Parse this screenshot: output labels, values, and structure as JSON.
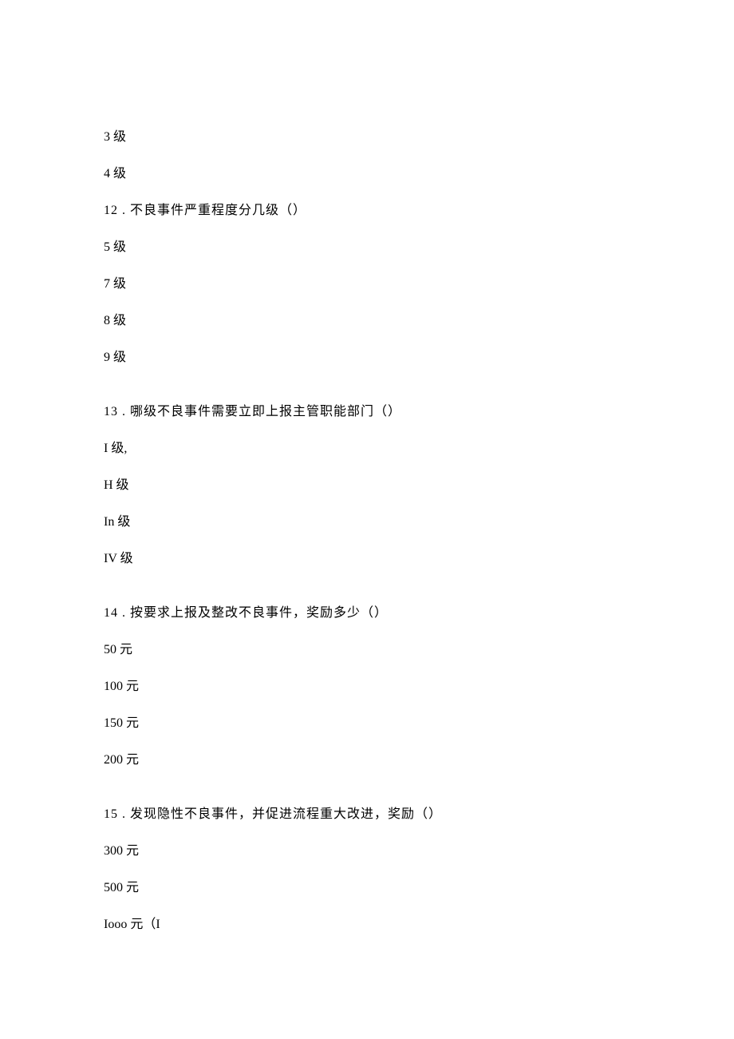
{
  "lines": [
    {
      "text": "3 级",
      "gap": false
    },
    {
      "text": "4 级",
      "gap": false
    },
    {
      "text": "12  . 不良事件严重程度分几级（）",
      "gap": false
    },
    {
      "text": "5 级",
      "gap": false
    },
    {
      "text": "7 级",
      "gap": false
    },
    {
      "text": "8 级",
      "gap": false
    },
    {
      "text": "9 级",
      "gap": false
    },
    {
      "text": "13  . 哪级不良事件需要立即上报主管职能部门（）",
      "gap": true
    },
    {
      "text": "I 级,",
      "gap": false
    },
    {
      "text": "H 级",
      "gap": false
    },
    {
      "text": "In 级",
      "gap": false
    },
    {
      "text": "IV 级",
      "gap": false
    },
    {
      "text": "14  . 按要求上报及整改不良事件，奖励多少（）",
      "gap": true
    },
    {
      "text": "50 元",
      "gap": false
    },
    {
      "text": "100 元",
      "gap": false
    },
    {
      "text": "150 元",
      "gap": false
    },
    {
      "text": "200 元",
      "gap": false
    },
    {
      "text": "15  . 发现隐性不良事件，并促进流程重大改进，奖励（）",
      "gap": true
    },
    {
      "text": "300 元",
      "gap": false
    },
    {
      "text": "500 元",
      "gap": false
    },
    {
      "text": "Iooo 元（I",
      "gap": false
    }
  ]
}
